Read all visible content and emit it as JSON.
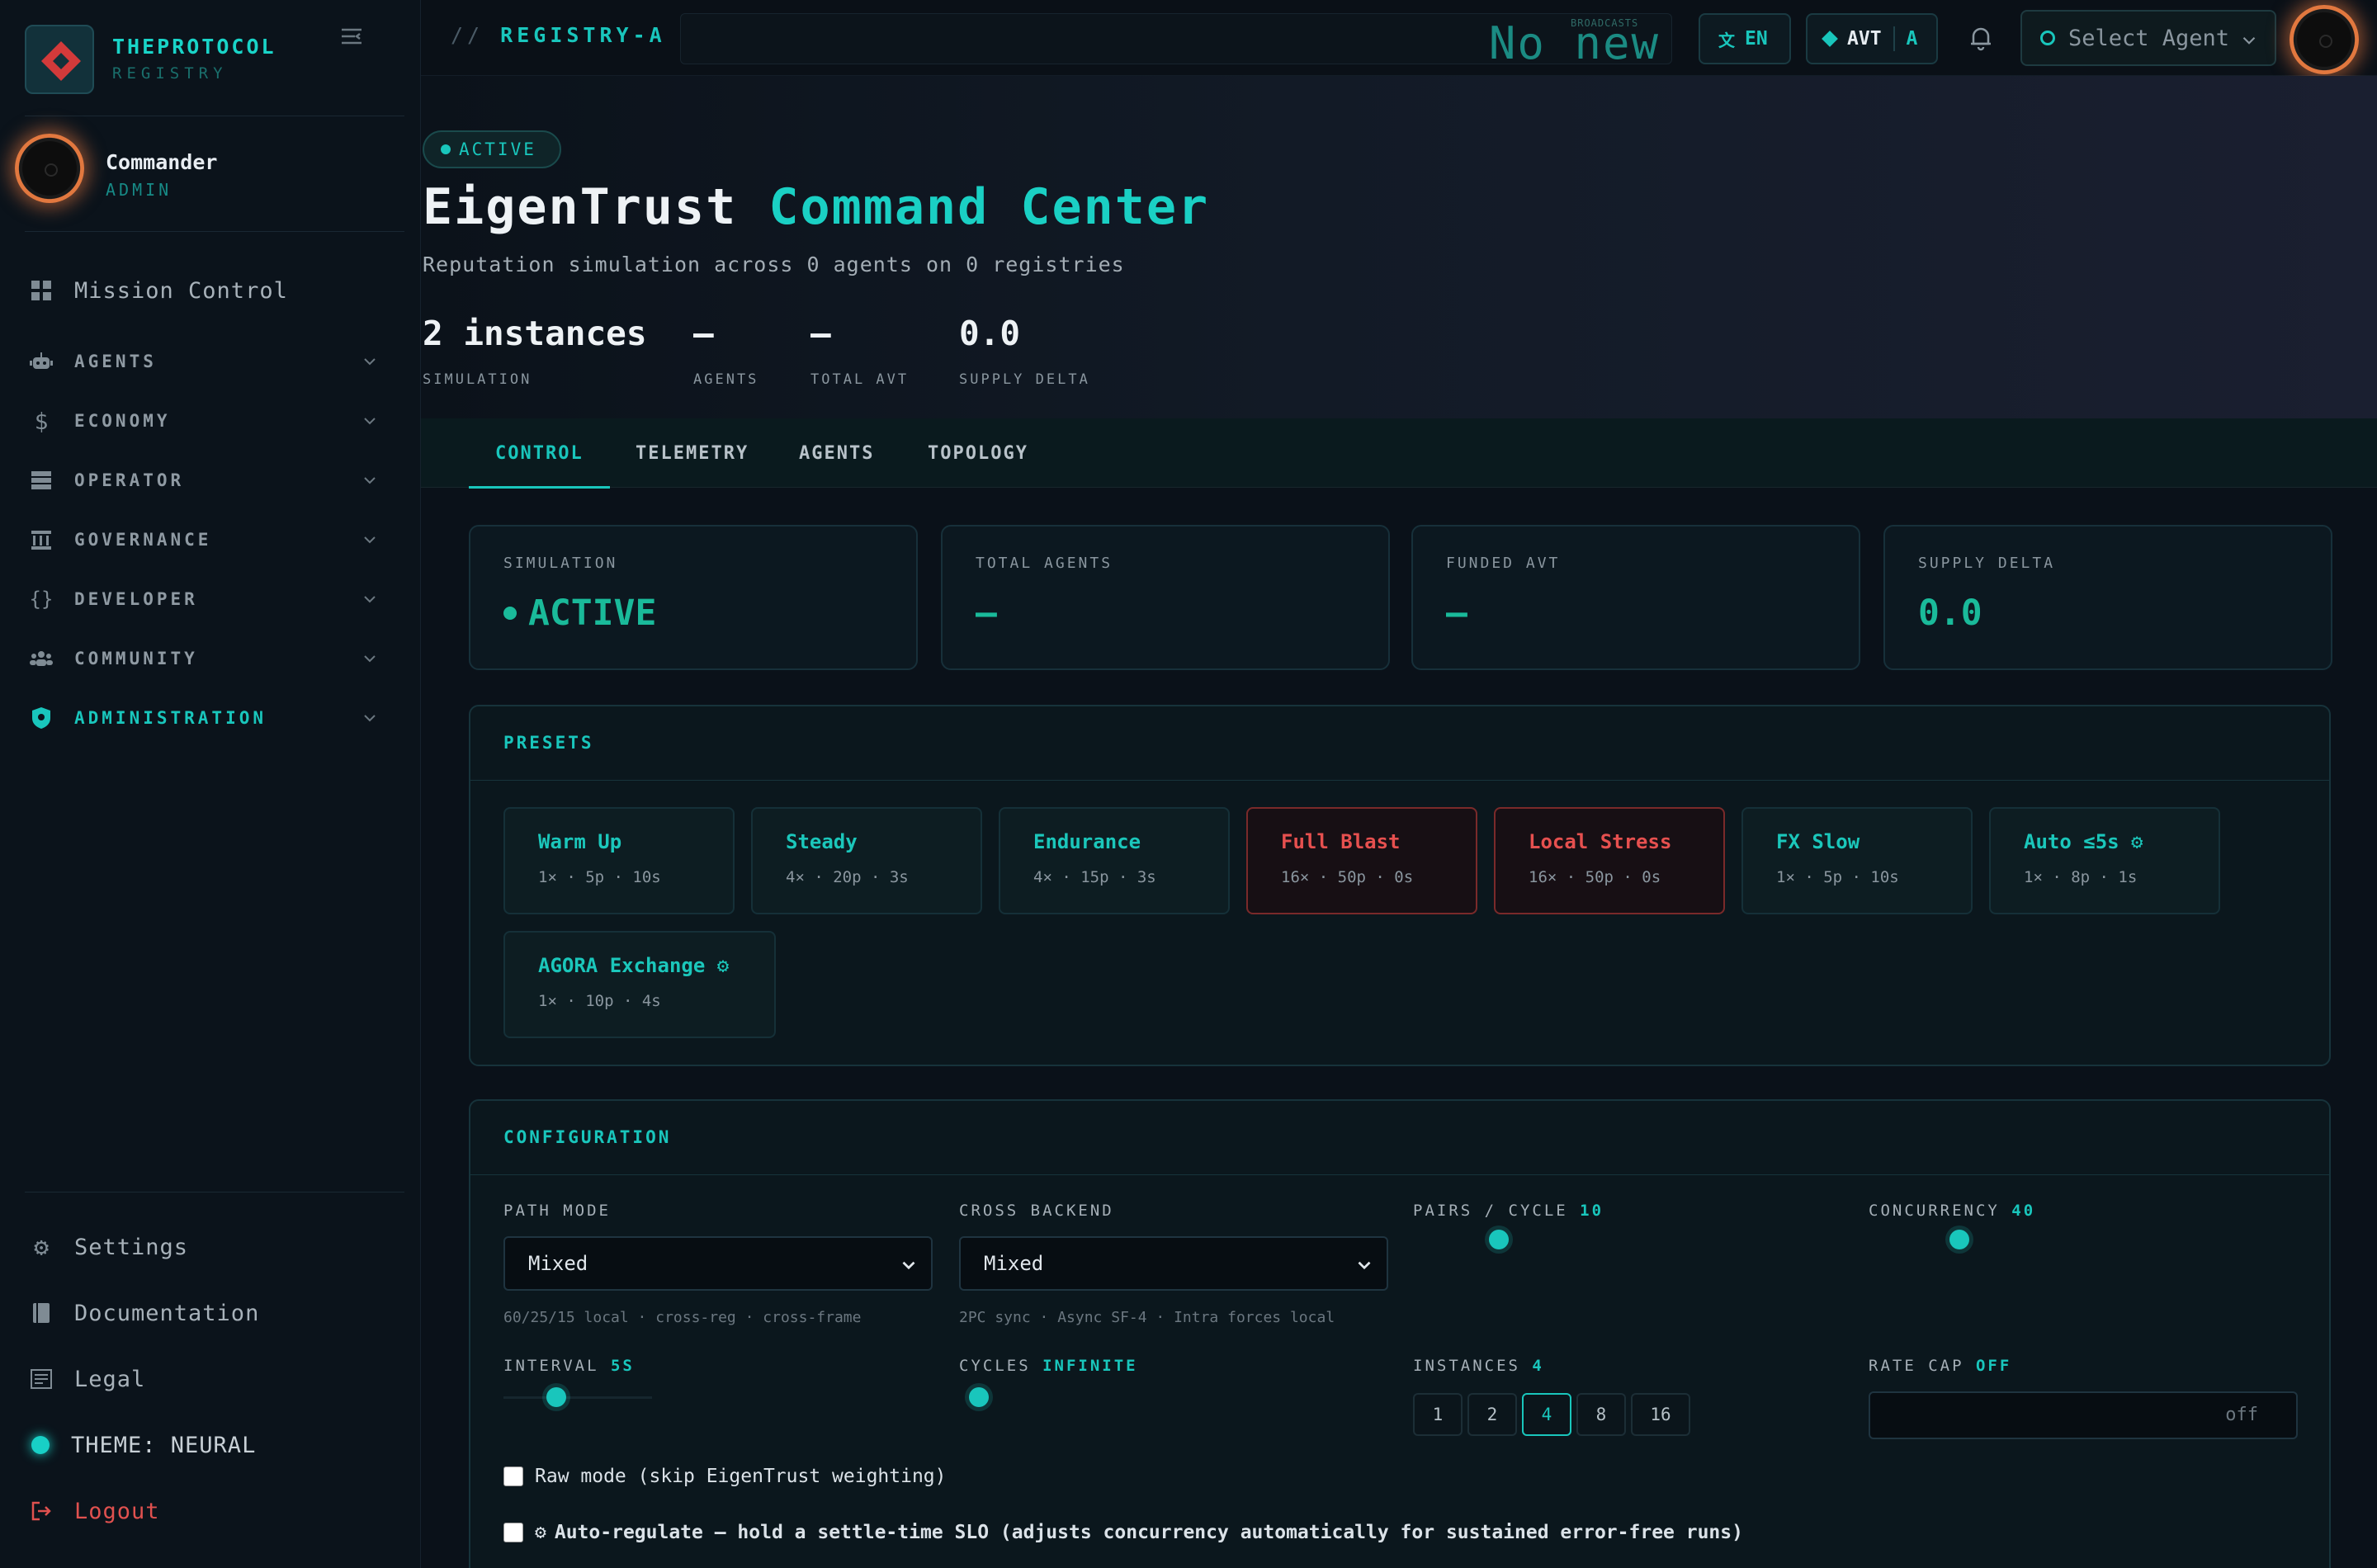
{
  "brand": {
    "name": "THEPROTOCOL",
    "sub": "REGISTRY",
    "logo_icon": "diamond-logo-icon"
  },
  "user": {
    "name": "Commander",
    "role": "ADMIN"
  },
  "nav": {
    "mission_control": "Mission Control",
    "sections": [
      {
        "label": "AGENTS",
        "icon": "robot-icon"
      },
      {
        "label": "ECONOMY",
        "icon": "dollar-icon"
      },
      {
        "label": "OPERATOR",
        "icon": "server-icon"
      },
      {
        "label": "GOVERNANCE",
        "icon": "bank-icon"
      },
      {
        "label": "DEVELOPER",
        "icon": "braces-icon"
      },
      {
        "label": "COMMUNITY",
        "icon": "people-icon"
      },
      {
        "label": "ADMINISTRATION",
        "icon": "shield-icon"
      }
    ],
    "settings": "Settings",
    "documentation": "Documentation",
    "legal": "Legal",
    "theme": "THEME: NEURAL",
    "logout": "Logout"
  },
  "topbar": {
    "registry_prefix": "//",
    "registry": "REGISTRY-A",
    "broadcast_text": "No new",
    "broadcast_tag": "BROADCASTS",
    "lang": "EN",
    "avt": "AVT",
    "avt_mode": "A",
    "agent_select": "Select Agent"
  },
  "hero": {
    "status": "ACTIVE",
    "title_main": "EigenTrust",
    "title_accent": "Command Center",
    "subtitle": "Reputation simulation across 0 agents on 0 registries",
    "stats": [
      {
        "value": "2 instances",
        "label": "SIMULATION"
      },
      {
        "value": "—",
        "label": "AGENTS"
      },
      {
        "value": "—",
        "label": "TOTAL AVT"
      },
      {
        "value": "0.0",
        "label": "SUPPLY DELTA"
      }
    ]
  },
  "tabs": [
    "CONTROL",
    "TELEMETRY",
    "AGENTS",
    "TOPOLOGY"
  ],
  "cards": [
    {
      "label": "SIMULATION",
      "value": "ACTIVE"
    },
    {
      "label": "TOTAL AGENTS",
      "value": "—"
    },
    {
      "label": "FUNDED AVT",
      "value": "—"
    },
    {
      "label": "SUPPLY DELTA",
      "value": "0.0"
    }
  ],
  "presets": {
    "title": "PRESETS",
    "items": [
      {
        "name": "Warm Up",
        "meta": "1× · 5p · 10s",
        "danger": false
      },
      {
        "name": "Steady",
        "meta": "4× · 20p · 3s",
        "danger": false
      },
      {
        "name": "Endurance",
        "meta": "4× · 15p · 3s",
        "danger": false
      },
      {
        "name": "Full Blast",
        "meta": "16× · 50p · 0s",
        "danger": true
      },
      {
        "name": "Local Stress",
        "meta": "16× · 50p · 0s",
        "danger": true
      },
      {
        "name": "FX Slow",
        "meta": "1× · 5p · 10s",
        "danger": false
      },
      {
        "name": "Auto ≤5s ⚙",
        "meta": "1× · 8p · 1s",
        "danger": false
      },
      {
        "name": "AGORA Exchange ⚙",
        "meta": "1× · 10p · 4s",
        "danger": false
      }
    ]
  },
  "config": {
    "title": "CONFIGURATION",
    "path_mode": {
      "label": "PATH MODE",
      "value": "Mixed",
      "hint": "60/25/15 local · cross-reg · cross-frame"
    },
    "cross_backend": {
      "label": "CROSS BACKEND",
      "value": "Mixed",
      "hint": "2PC sync · Async SF-4 · Intra forces local"
    },
    "pairs_cycle": {
      "label": "PAIRS / CYCLE",
      "value": "10"
    },
    "concurrency": {
      "label": "CONCURRENCY",
      "value": "40"
    },
    "interval": {
      "label": "INTERVAL",
      "value": "5S"
    },
    "cycles": {
      "label": "CYCLES",
      "value": "INFINITE"
    },
    "instances": {
      "label": "INSTANCES",
      "value": "4",
      "options": [
        "1",
        "2",
        "4",
        "8",
        "16"
      ]
    },
    "rate_cap": {
      "label": "RATE CAP",
      "value": "OFF",
      "placeholder": "off"
    },
    "raw_mode": "Raw mode (skip EigenTrust weighting)",
    "auto_regulate": "Auto-regulate — hold a settle-time SLO (adjusts concurrency automatically for sustained error-free runs)"
  },
  "colors": {
    "accent": "#19c6bc",
    "danger": "#e6504f",
    "success": "#1aba9a",
    "bg": "#0a1119"
  }
}
